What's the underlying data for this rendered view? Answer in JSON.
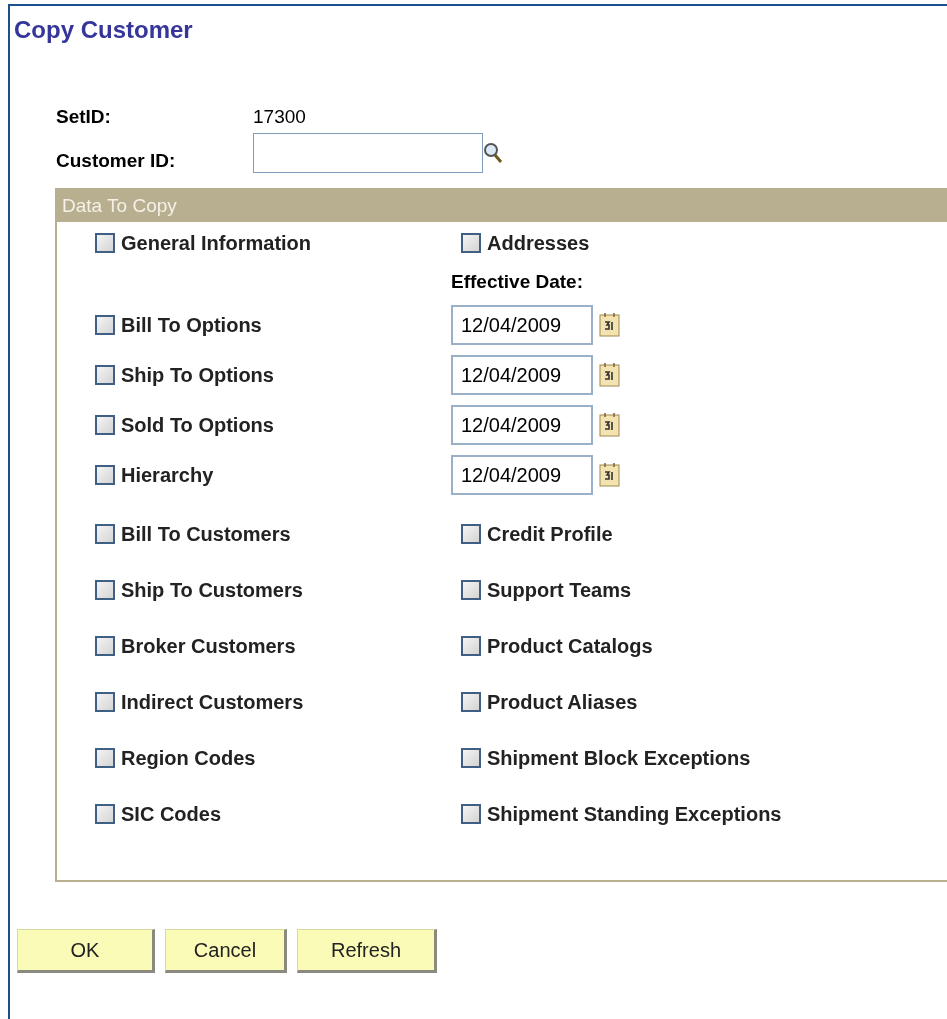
{
  "title": "Copy Customer",
  "setid": {
    "label": "SetID:",
    "value": "17300"
  },
  "customer_id": {
    "label": "Customer ID:"
  },
  "panel": {
    "title": "Data To Copy",
    "top_row": [
      {
        "label": "General Information",
        "checked": false
      },
      {
        "label": "Addresses",
        "checked": false
      }
    ],
    "effective_date_label": "Effective Date:",
    "date_rows": [
      {
        "label": "Bill To Options",
        "checked": false,
        "date": "12/04/2009"
      },
      {
        "label": "Ship To Options",
        "checked": false,
        "date": "12/04/2009"
      },
      {
        "label": "Sold To Options",
        "checked": false,
        "date": "12/04/2009"
      },
      {
        "label": "Hierarchy",
        "checked": false,
        "date": "12/04/2009"
      }
    ],
    "pair_rows": [
      [
        {
          "label": "Bill To Customers",
          "checked": false
        },
        {
          "label": "Credit Profile",
          "checked": false
        }
      ],
      [
        {
          "label": "Ship To Customers",
          "checked": false
        },
        {
          "label": "Support Teams",
          "checked": false
        }
      ],
      [
        {
          "label": "Broker Customers",
          "checked": false
        },
        {
          "label": "Product Catalogs",
          "checked": false
        }
      ],
      [
        {
          "label": "Indirect Customers",
          "checked": false
        },
        {
          "label": "Product Aliases",
          "checked": false
        }
      ],
      [
        {
          "label": "Region Codes",
          "checked": false
        },
        {
          "label": "Shipment Block Exceptions",
          "checked": false
        }
      ],
      [
        {
          "label": "SIC Codes",
          "checked": false
        },
        {
          "label": "Shipment Standing Exceptions",
          "checked": false
        }
      ]
    ]
  },
  "buttons": [
    "OK",
    "Cancel",
    "Refresh"
  ]
}
